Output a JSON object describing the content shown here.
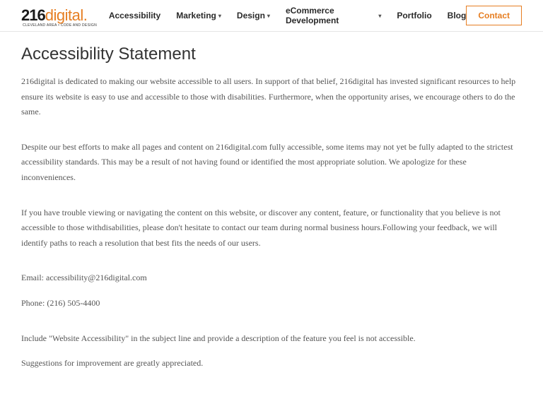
{
  "logo": {
    "part1": "216",
    "part2": "digital",
    "dot": ".",
    "tagline": "CLEVELAND AREA • CODE AND DESIGN"
  },
  "nav": {
    "accessibility": "Accessibility",
    "marketing": "Marketing",
    "design": "Design",
    "ecommerce": "eCommerce Development",
    "portfolio": "Portfolio",
    "blog": "Blog",
    "contact": "Contact"
  },
  "title": "Accessibility Statement",
  "p1": "216digital is dedicated to making our website accessible to all users. In support of that belief, 216digital has invested significant resources to help ensure its website is easy to use and accessible to those with disabilities. Furthermore, when the opportunity arises, we encourage others to do the same.",
  "p2": "Despite our best efforts to make all pages and content on 216digital.com fully accessible, some items may not yet be fully adapted to the strictest accessibility standards. This may be a result of not having found or identified the most appropriate solution. We apologize for these inconveniences.",
  "p3": "If you have trouble viewing or navigating the content on this website, or discover any content, feature, or functionality that you believe is not accessible to those withdisabilities, please don't hesitate to contact our team during normal business hours.Following your feedback, we will identify paths to reach a resolution that best fits the needs of our users.",
  "email": "Email: accessibility@216digital.com",
  "phone": "Phone: (216) 505-4400",
  "p4": "Include \"Website Accessibility\" in the subject line and provide a description of the feature you feel is not accessible.",
  "p5": "Suggestions for improvement are greatly appreciated."
}
